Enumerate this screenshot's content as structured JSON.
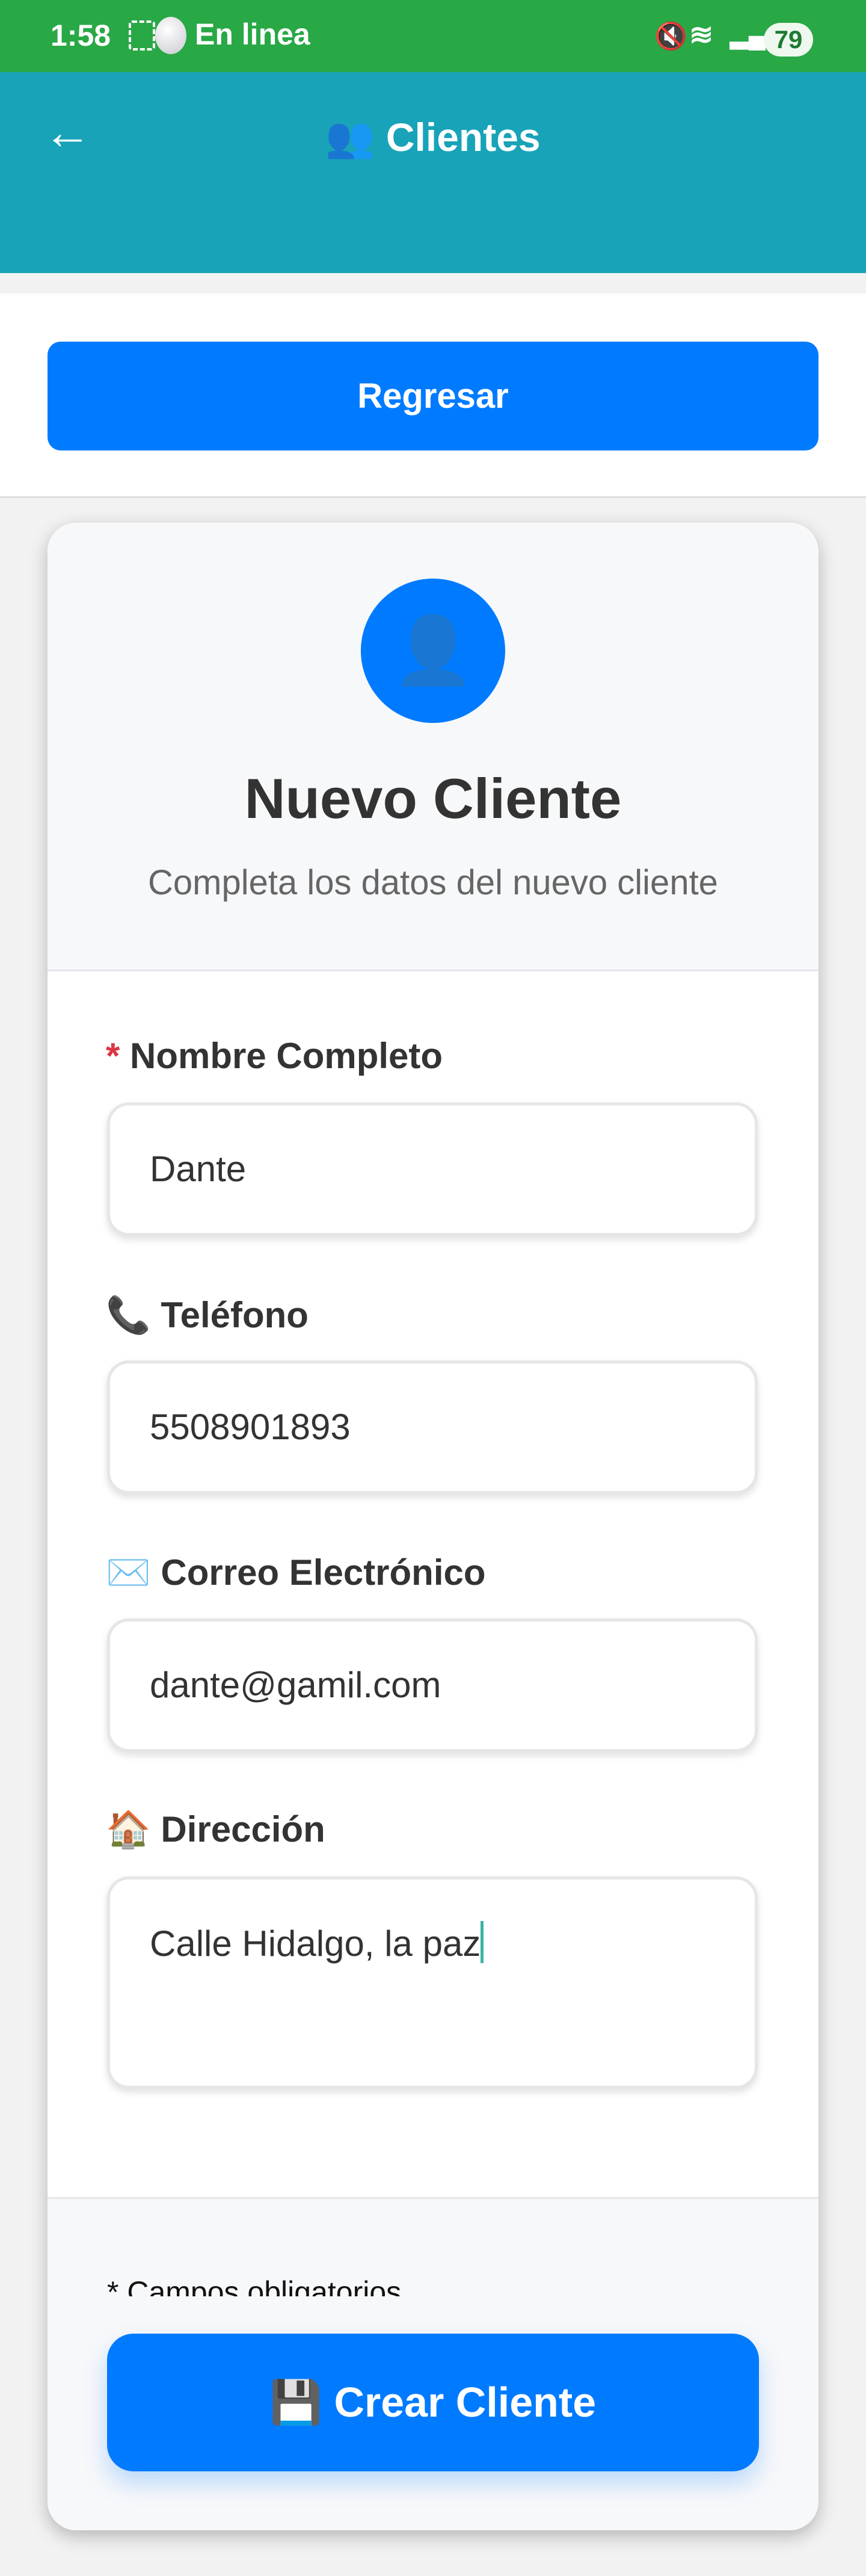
{
  "status_bar": {
    "time": "1:58",
    "notification": "En linea",
    "battery": "79"
  },
  "app_bar": {
    "title_icon": "👥",
    "title": "Clientes",
    "back_icon": "←"
  },
  "top": {
    "back_button": "Regresar"
  },
  "form": {
    "avatar_icon": "👤",
    "title": "Nuevo Cliente",
    "subtitle": "Completa los datos del nuevo cliente",
    "fields": [
      {
        "icon": "*",
        "label": "Nombre Completo",
        "value": "Dante"
      },
      {
        "icon": "📞",
        "label": "Teléfono",
        "value": "5508901893"
      },
      {
        "icon": "✉️",
        "label": "Correo Electrónico",
        "value": "dante@gamil.com"
      },
      {
        "icon": "🏠",
        "label": "Dirección",
        "value": "Calle Hidalgo, la paz"
      }
    ],
    "required_note": "* Campos obligatorios",
    "submit_icon": "💾",
    "submit_label": "Crear Cliente"
  },
  "colors": {
    "status": "#29a846",
    "appbar": "#18a3b8",
    "primary": "#007bff",
    "required": "#dc3545"
  }
}
